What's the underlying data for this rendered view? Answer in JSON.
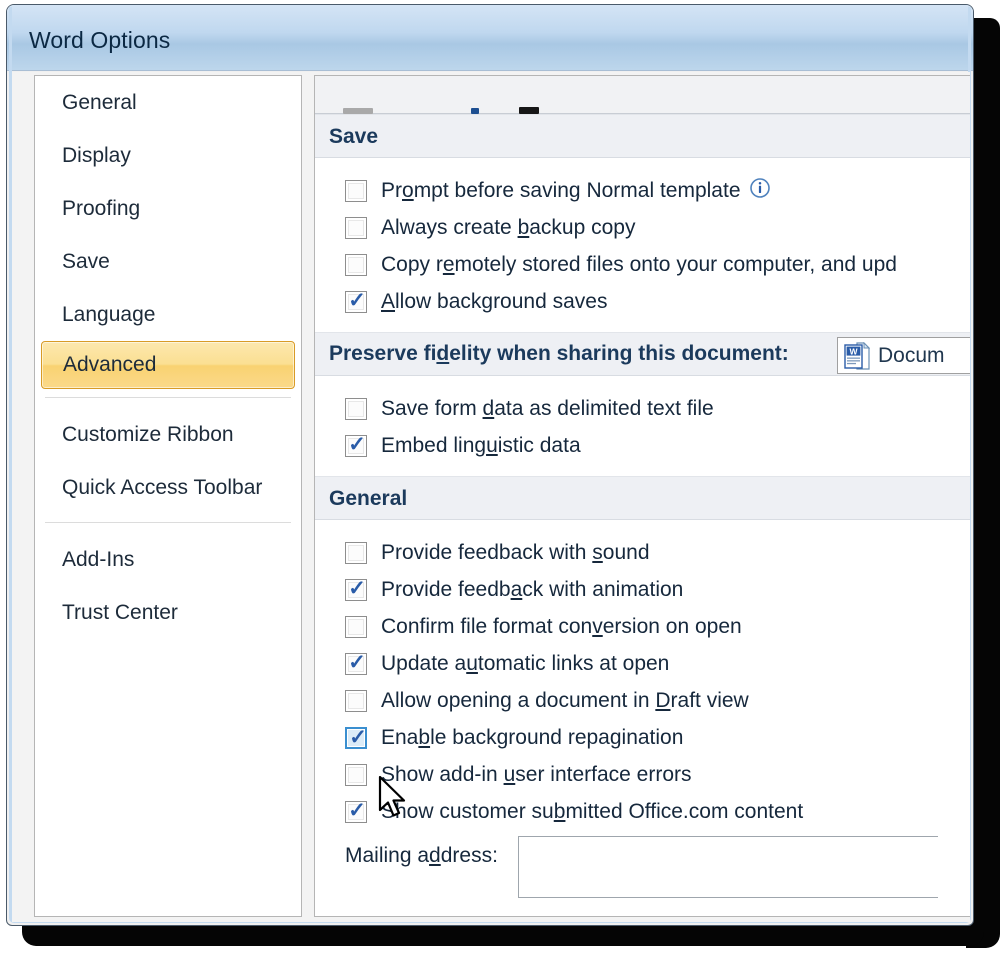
{
  "window": {
    "title": "Word Options"
  },
  "sidebar": {
    "items": [
      {
        "label": "General",
        "selected": false,
        "separator_after": false
      },
      {
        "label": "Display",
        "selected": false,
        "separator_after": false
      },
      {
        "label": "Proofing",
        "selected": false,
        "separator_after": false
      },
      {
        "label": "Save",
        "selected": false,
        "separator_after": false
      },
      {
        "label": "Language",
        "selected": false,
        "separator_after": false
      },
      {
        "label": "Advanced",
        "selected": true,
        "separator_after": true
      },
      {
        "label": "Customize Ribbon",
        "selected": false,
        "separator_after": false
      },
      {
        "label": "Quick Access Toolbar",
        "selected": false,
        "separator_after": true
      },
      {
        "label": "Add-Ins",
        "selected": false,
        "separator_after": false
      },
      {
        "label": "Trust Center",
        "selected": false,
        "separator_after": false
      }
    ]
  },
  "content": {
    "sections": [
      {
        "id": "save",
        "header": "Save",
        "options": [
          {
            "label": "Prompt before saving Normal template",
            "accel": "o",
            "checked": false,
            "state": "normal",
            "info_icon": true
          },
          {
            "label": "Always create backup copy",
            "accel": "b",
            "checked": false,
            "state": "normal",
            "info_icon": false
          },
          {
            "label": "Copy remotely stored files onto your computer, and upd",
            "accel": "e",
            "checked": false,
            "state": "normal",
            "info_icon": false
          },
          {
            "label": "Allow background saves",
            "accel": "A",
            "checked": true,
            "state": "normal",
            "info_icon": false
          }
        ]
      },
      {
        "id": "preserve-fidelity",
        "header": "Preserve fidelity when sharing this document:",
        "header_accel": "d",
        "combo_value": "Docum",
        "combo_icon": "word-document-icon",
        "options": [
          {
            "label": "Save form data as delimited text file",
            "accel": "d",
            "checked": false,
            "state": "normal",
            "info_icon": false
          },
          {
            "label": "Embed linguistic data",
            "accel": "u",
            "checked": true,
            "state": "normal",
            "info_icon": false
          }
        ]
      },
      {
        "id": "general",
        "header": "General",
        "options": [
          {
            "label": "Provide feedback with sound",
            "accel": "s",
            "checked": false,
            "state": "normal",
            "info_icon": false
          },
          {
            "label": "Provide feedback with animation",
            "accel": "a",
            "checked": true,
            "state": "normal",
            "info_icon": false
          },
          {
            "label": "Confirm file format conversion on open",
            "accel": "v",
            "checked": false,
            "state": "normal",
            "info_icon": false
          },
          {
            "label": "Update automatic links at open",
            "accel": "u",
            "checked": true,
            "state": "normal",
            "info_icon": false
          },
          {
            "label": "Allow opening a document in Draft view",
            "accel": "D",
            "checked": false,
            "state": "normal",
            "info_icon": false
          },
          {
            "label": "Enable background repagination",
            "accel": "b",
            "checked": true,
            "state": "hover",
            "info_icon": false
          },
          {
            "label": "Show add-in user interface errors",
            "accel": "u",
            "checked": false,
            "state": "normal",
            "info_icon": false
          },
          {
            "label": "Show customer submitted Office.com content",
            "accel": "b",
            "checked": true,
            "state": "normal",
            "info_icon": false
          }
        ],
        "mailing": {
          "label": "Mailing address:",
          "accel": "d",
          "value": "",
          "placeholder": ""
        }
      }
    ]
  },
  "icons": {
    "check_glyph": "✓",
    "info_glyph": "i"
  },
  "colors": {
    "titlebar_top": "#d4e4f5",
    "titlebar_bottom": "#a9c8e4",
    "selected_nav_fill": "#fbdf92",
    "selected_nav_border": "#d89b26",
    "section_header_bg": "#eef0f4",
    "section_header_text": "#1b3a5c",
    "checkbox_check": "#2a5ca8",
    "hover_checkbox_border": "#3a8fd0",
    "hover_checkbox_fill": "#dcecf8",
    "body_text": "#16283c",
    "dialog_frame": "#c3daf0"
  }
}
